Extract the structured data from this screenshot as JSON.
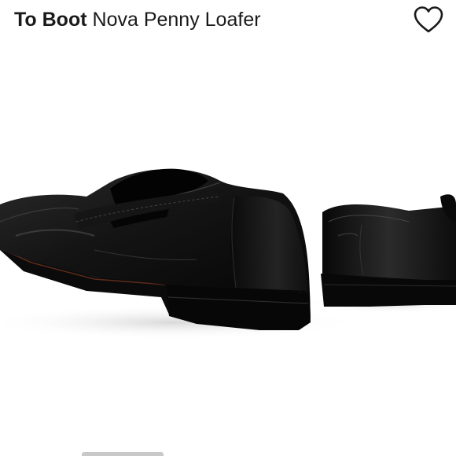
{
  "header": {
    "brand": "To Boot",
    "product": "Nova Penny Loafer",
    "favorite_icon": "heart-outline-icon"
  },
  "product_image": {
    "subject": "black leather penny loafers",
    "color": "#111111"
  },
  "carousel": {
    "indicator_color": "#c8c8c8"
  }
}
